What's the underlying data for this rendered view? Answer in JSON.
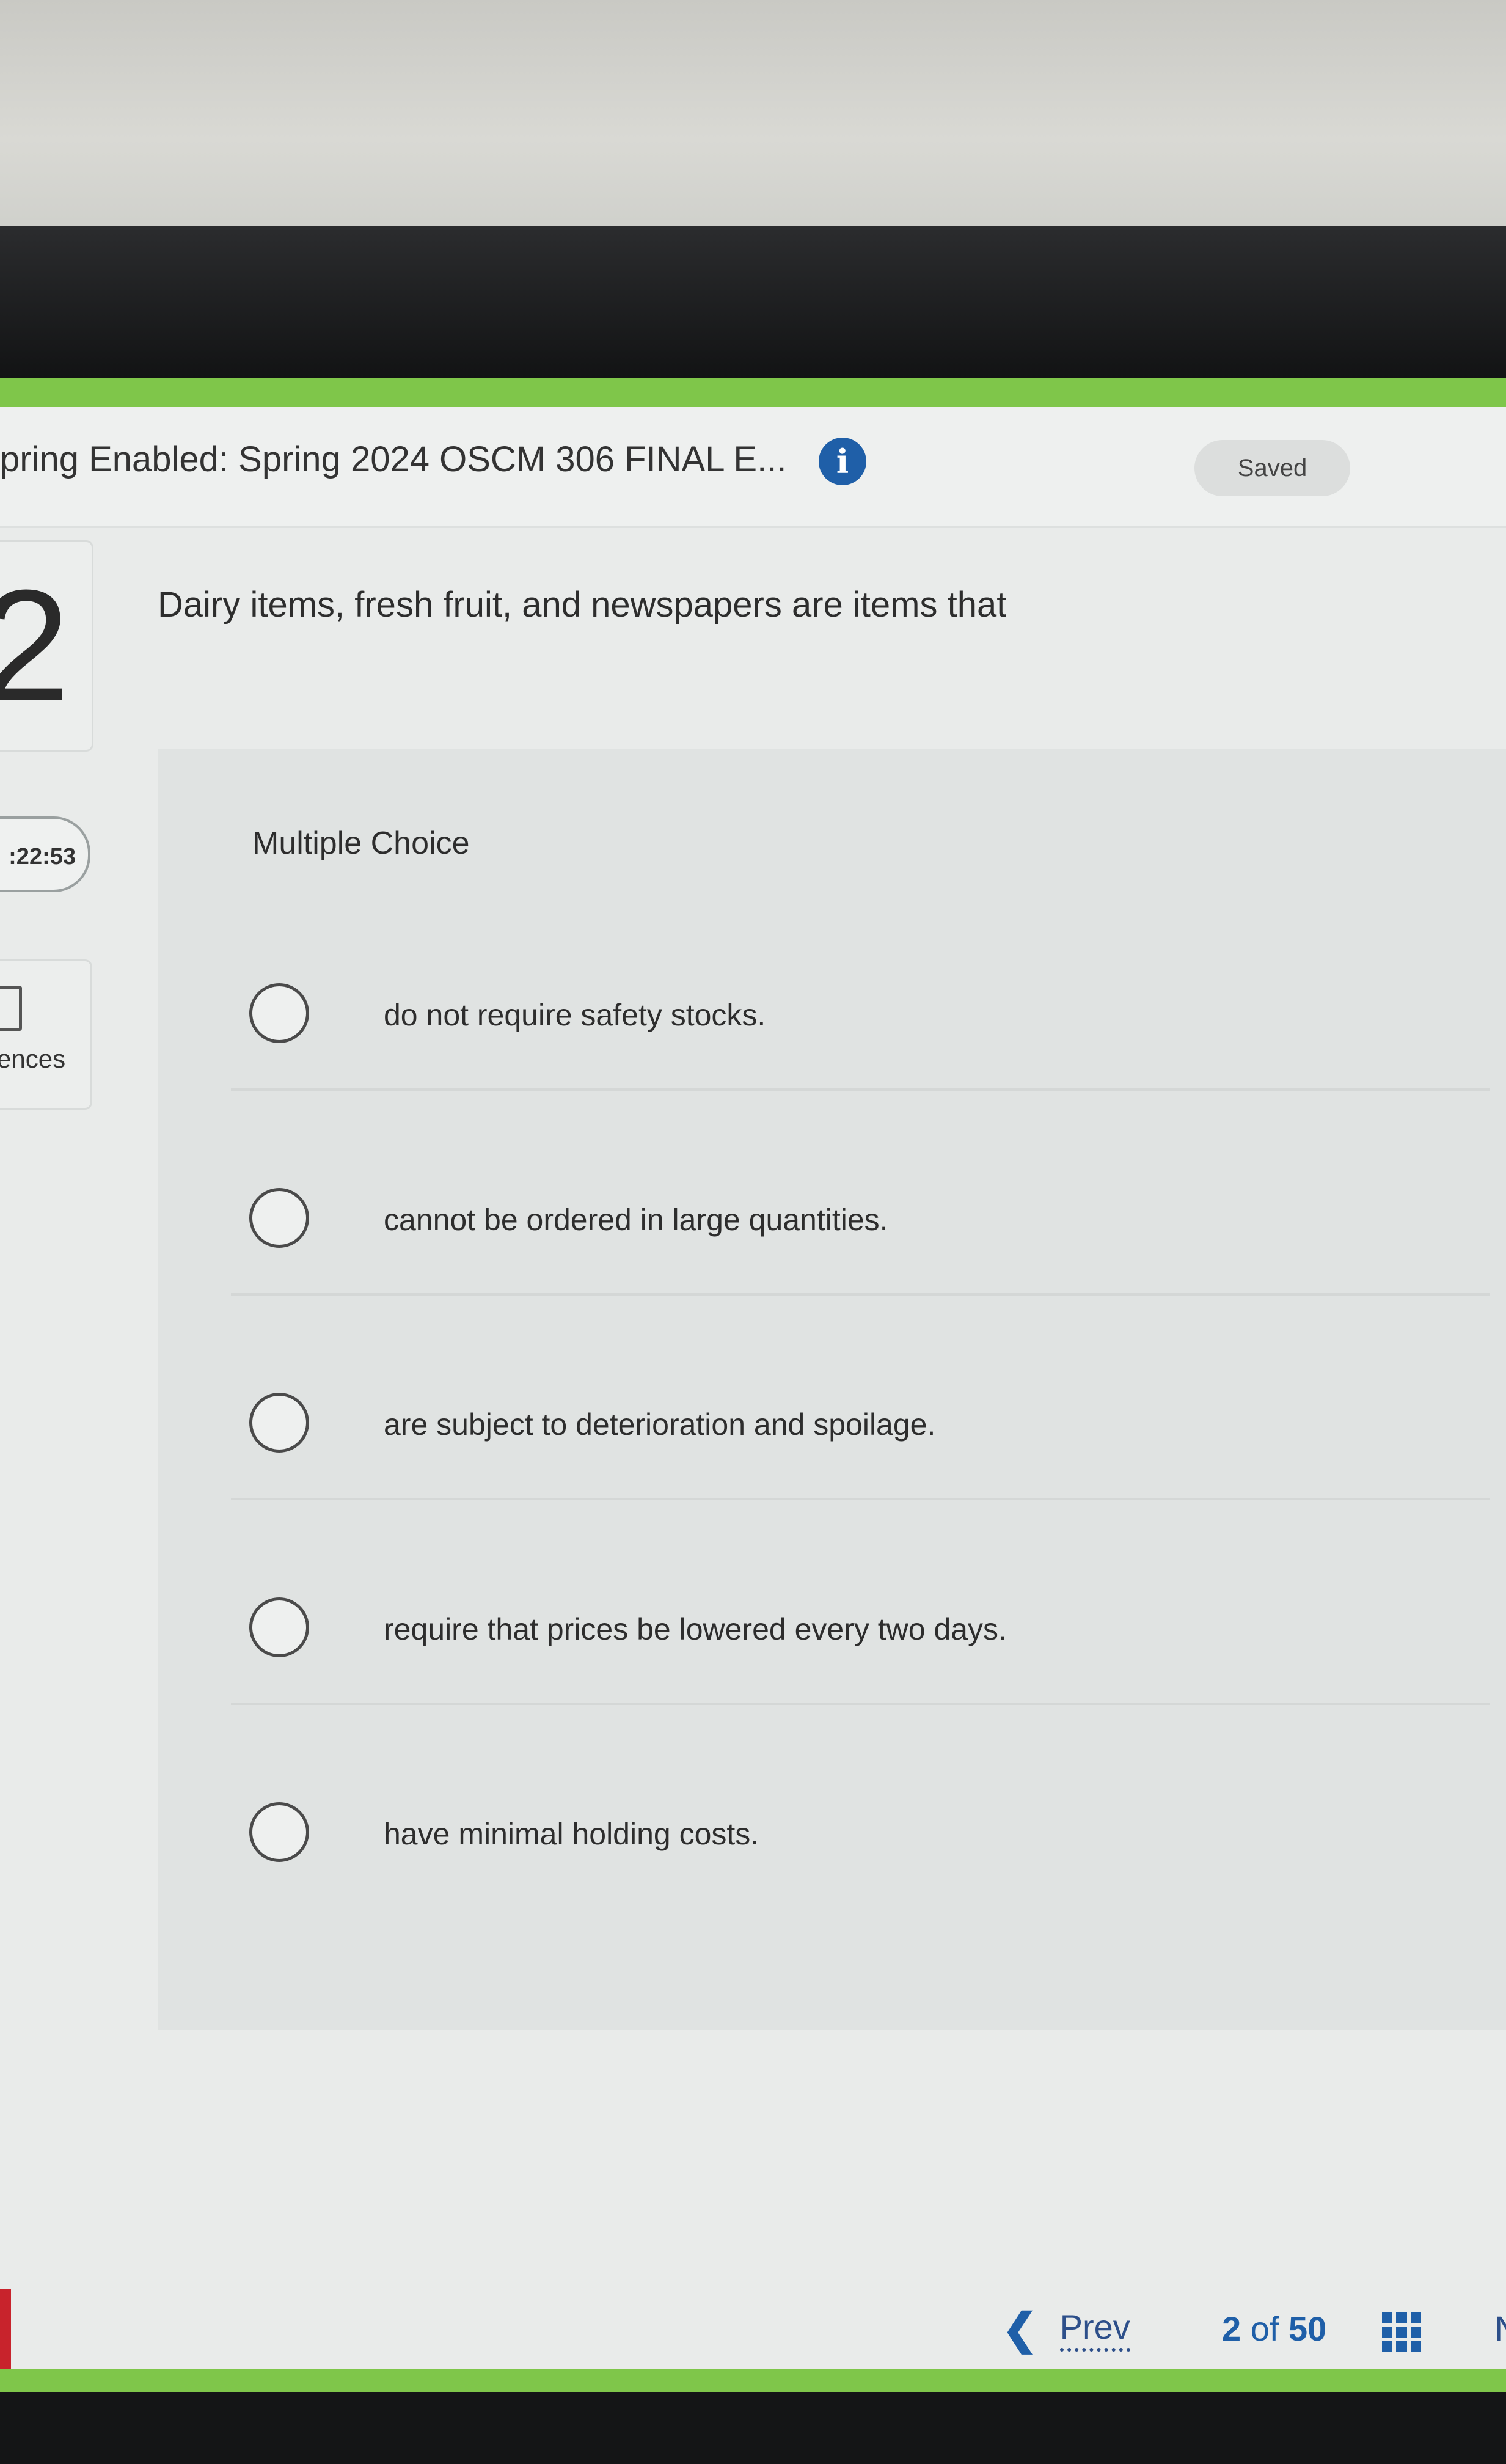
{
  "header": {
    "title": "pring Enabled: Spring 2024 OSCM 306 FINAL E...",
    "info_icon": "info-icon",
    "status": "Saved"
  },
  "sidebar": {
    "question_number": "2",
    "timer": ":22:53",
    "references_label": "ences"
  },
  "question": {
    "text": "Dairy items, fresh fruit, and newspapers are items that",
    "type_label": "Multiple Choice",
    "options": [
      "do not require safety stocks.",
      "cannot be ordered in large quantities.",
      "are subject to deterioration and spoilage.",
      "require that prices be lowered every two days.",
      "have minimal holding costs."
    ]
  },
  "footer": {
    "prev_label": "Prev",
    "current_page": "2",
    "of_label": "of",
    "total_pages": "50",
    "next_peek": "N"
  },
  "colors": {
    "accent_green": "#7fc64a",
    "link_blue": "#1f5fa8",
    "marker_red": "#c8232c"
  }
}
